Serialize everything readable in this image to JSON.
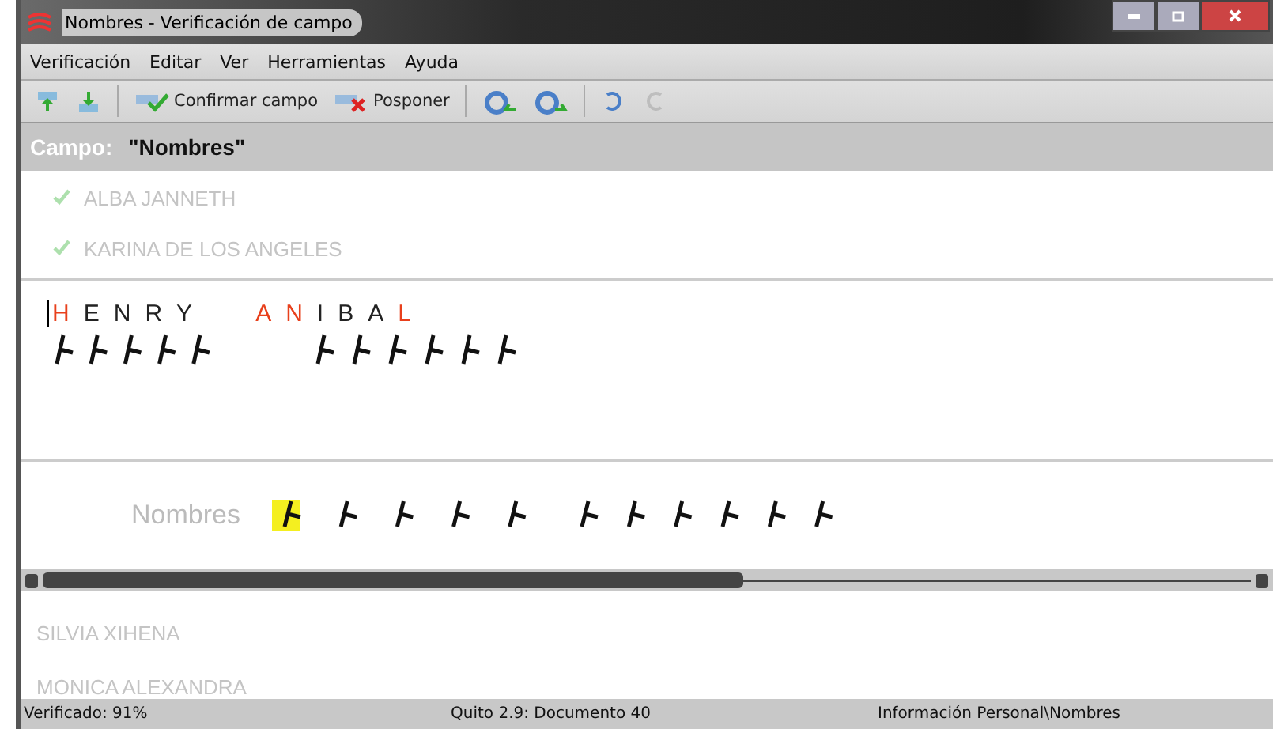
{
  "window": {
    "title": "Nombres - Verificación de campo"
  },
  "menu": [
    "Verificación",
    "Editar",
    "Ver",
    "Herramientas",
    "Ayuda"
  ],
  "toolbar": [
    {
      "kind": "up"
    },
    {
      "kind": "down"
    },
    {
      "kind": "confirm",
      "label": "Confirmar campo"
    },
    {
      "kind": "postpone",
      "label": "Posponer"
    },
    {
      "kind": "prev-a"
    },
    {
      "kind": "next-a"
    },
    {
      "kind": "undo",
      "disabled": false
    },
    {
      "kind": "redo",
      "disabled": true
    }
  ],
  "field": {
    "label": "Campo:",
    "value": "\"Nombres\""
  },
  "records_above": [
    {
      "text": "ALBA JANNETH",
      "checked": true
    },
    {
      "text": "KARINA DE LOS ANGELES",
      "checked": true
    }
  ],
  "entry": {
    "words": [
      [
        {
          "char": "H",
          "flagged": true
        },
        {
          "char": "E",
          "flagged": false
        },
        {
          "char": "N",
          "flagged": false
        },
        {
          "char": "R",
          "flagged": false
        },
        {
          "char": "Y",
          "flagged": false
        }
      ],
      [
        {
          "char": "A",
          "flagged": true
        },
        {
          "char": "N",
          "flagged": true
        },
        {
          "char": "I",
          "flagged": false
        },
        {
          "char": "B",
          "flagged": false
        },
        {
          "char": "A",
          "flagged": false
        },
        {
          "char": "L",
          "flagged": true
        }
      ]
    ]
  },
  "compare": {
    "label": "Nombres"
  },
  "records_below": [
    {
      "text": "SILVIA XIHENA",
      "checked": false
    },
    {
      "text": "MONICA ALEXANDRA",
      "checked": false
    }
  ],
  "status_bar": [
    "Verificado: 91%",
    "Quito 2.9: Documento 40",
    "Información Personal\\Nombres"
  ]
}
